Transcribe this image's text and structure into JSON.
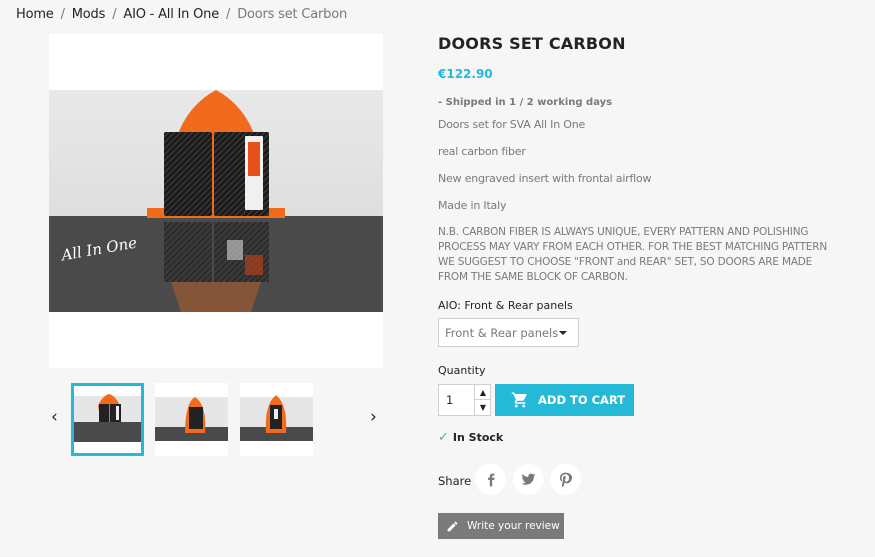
{
  "breadcrumb": {
    "items": [
      "Home",
      "Mods",
      "AIO - All In One",
      "Doors set Carbon"
    ],
    "separator": "/"
  },
  "product": {
    "title": "DOORS SET CARBON",
    "price": "€122.90",
    "shipping": "- Shipped in 1 / 2 working days",
    "description": [
      "Doors set for SVA All In One",
      "real carbon fiber",
      "New engraved insert with frontal airflow",
      "Made in Italy"
    ],
    "note": "N.B.  CARBON FIBER IS ALWAYS UNIQUE, EVERY PATTERN AND POLISHING PROCESS MAY VARY FROM EACH OTHER. FOR THE BEST MATCHING PATTERN WE SUGGEST TO CHOOSE \"FRONT and REAR\" SET, SO DOORS ARE MADE FROM THE SAME BLOCK OF CARBON.",
    "image_logo": "All In One"
  },
  "variant": {
    "label": "AIO: Front & Rear panels",
    "selected": "Front & Rear panels"
  },
  "quantity": {
    "label": "Quantity",
    "value": "1"
  },
  "cart": {
    "label": "ADD TO CART"
  },
  "availability": {
    "label": "In Stock"
  },
  "share": {
    "label": "Share",
    "networks": [
      "facebook-icon",
      "twitter-icon",
      "pinterest-icon"
    ]
  },
  "review": {
    "label": "Write your review"
  },
  "colors": {
    "accent": "#24b9d7",
    "text_dark": "#232323",
    "text_muted": "#7a7a7a",
    "stock_green": "#4cbb6c",
    "product_orange": "#f26a1b"
  }
}
